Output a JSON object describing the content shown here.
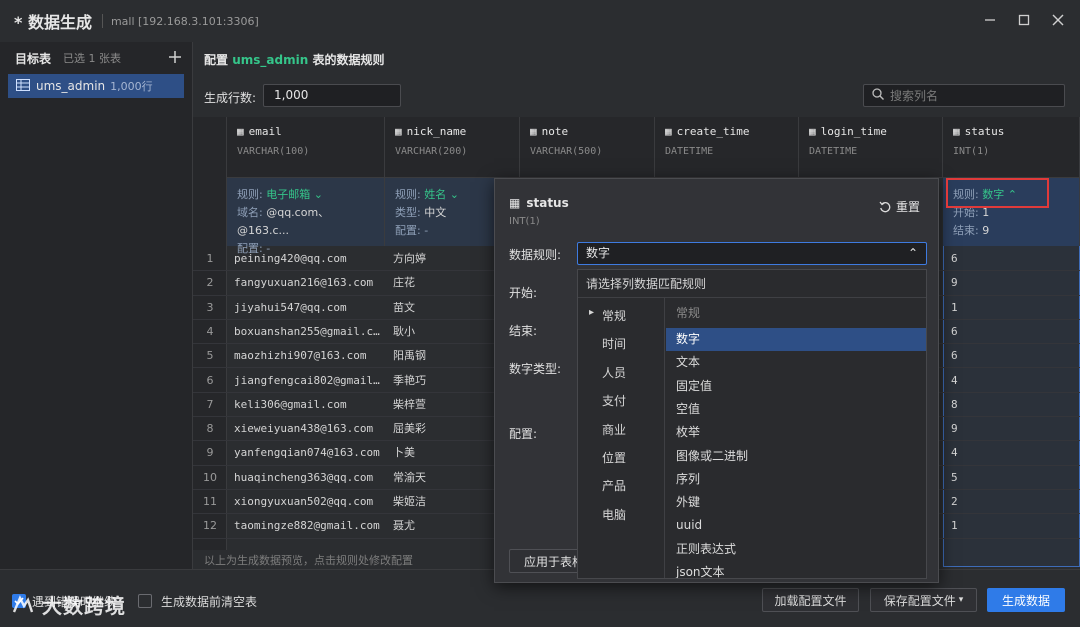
{
  "window": {
    "title": "* 数据生成",
    "connection": "mall [192.168.3.101:3306]"
  },
  "left": {
    "header": "目标表",
    "selected": "已选 1 张表",
    "table_name": "ums_admin",
    "table_count": "1,000行"
  },
  "main": {
    "config_prefix": "配置",
    "config_table": "ums_admin",
    "config_suffix": "表的数据规则",
    "rows_label": "生成行数:",
    "rows_value": "1,000",
    "search_placeholder": "搜索列名",
    "preview_note": "以上为生成数据预览，点击规则处修改配置"
  },
  "columns": [
    {
      "name": "email",
      "type": "VARCHAR(100)",
      "rule_label": "规则:",
      "rule": "电子邮箱",
      "line2_label": "域名:",
      "line2": "@qq.com、 @163.c...",
      "line3_label": "配置:",
      "line3": "-"
    },
    {
      "name": "nick_name",
      "type": "VARCHAR(200)",
      "rule_label": "规则:",
      "rule": "姓名",
      "line2_label": "类型:",
      "line2": "中文",
      "line3_label": "配置:",
      "line3": "-"
    },
    {
      "name": "note",
      "type": "VARCHAR(500)"
    },
    {
      "name": "create_time",
      "type": "DATETIME"
    },
    {
      "name": "login_time",
      "type": "DATETIME"
    },
    {
      "name": "status",
      "type": "INT(1)",
      "rule_label": "规则:",
      "rule": "数字",
      "line2_label": "开始:",
      "line2": "1",
      "line3_label": "结束:",
      "line3": "9"
    }
  ],
  "rows": [
    {
      "i": "1",
      "email": "peining420@qq.com",
      "nick": "方向婷",
      "status": "6"
    },
    {
      "i": "2",
      "email": "fangyuxuan216@163.com",
      "nick": "庄花",
      "status": "9"
    },
    {
      "i": "3",
      "email": "jiyahui547@qq.com",
      "nick": "苗文",
      "status": "1"
    },
    {
      "i": "4",
      "email": "boxuanshan255@gmail.c...",
      "nick": "耿小",
      "status": "6"
    },
    {
      "i": "5",
      "email": "maozhizhi907@163.com",
      "nick": "阳禹钢",
      "status": "6"
    },
    {
      "i": "6",
      "email": "jiangfengcai802@gmail...",
      "nick": "季艳巧",
      "status": "4"
    },
    {
      "i": "7",
      "email": "keli306@gmail.com",
      "nick": "柴梓萱",
      "status": "8"
    },
    {
      "i": "8",
      "email": "xieweiyuan438@163.com",
      "nick": "屈美彩",
      "status": "9"
    },
    {
      "i": "9",
      "email": "yanfengqian074@163.com",
      "nick": "卜美",
      "status": "4"
    },
    {
      "i": "10",
      "email": "huaqincheng363@qq.com",
      "nick": "常渝天",
      "status": "5"
    },
    {
      "i": "11",
      "email": "xiongyuxuan502@qq.com",
      "nick": "柴姬洁",
      "status": "2"
    },
    {
      "i": "12",
      "email": "taomingze882@gmail.com",
      "nick": "聂尤",
      "status": "1"
    }
  ],
  "popup": {
    "column": "status",
    "type": "INT(1)",
    "reset": "重置",
    "rule_label": "数据规则:",
    "rule_value": "数字",
    "start_label": "开始:",
    "end_label": "结束:",
    "numtype_label": "数字类型:",
    "config_label": "配置:",
    "apply": "应用于表格",
    "dropdown_header": "请选择列数据匹配规则",
    "categories": [
      "常规",
      "时间",
      "人员",
      "支付",
      "商业",
      "位置",
      "产品",
      "电脑"
    ],
    "group_title": "常规",
    "items": [
      "数字",
      "文本",
      "固定值",
      "空值",
      "枚举",
      "图像或二进制",
      "序列",
      "外键",
      "uuid",
      "正则表达式",
      "json文本"
    ]
  },
  "bottom": {
    "continue_on_error": "遇到错误时继续",
    "clear_before": "生成数据前清空表",
    "load_config": "加载配置文件",
    "save_config": "保存配置文件",
    "generate": "生成数据"
  },
  "watermark": "大数跨境",
  "colors": {
    "accent": "#2f7be8",
    "green": "#35c58a",
    "highlight": "#e03a3a",
    "selected": "#2e4f86"
  }
}
